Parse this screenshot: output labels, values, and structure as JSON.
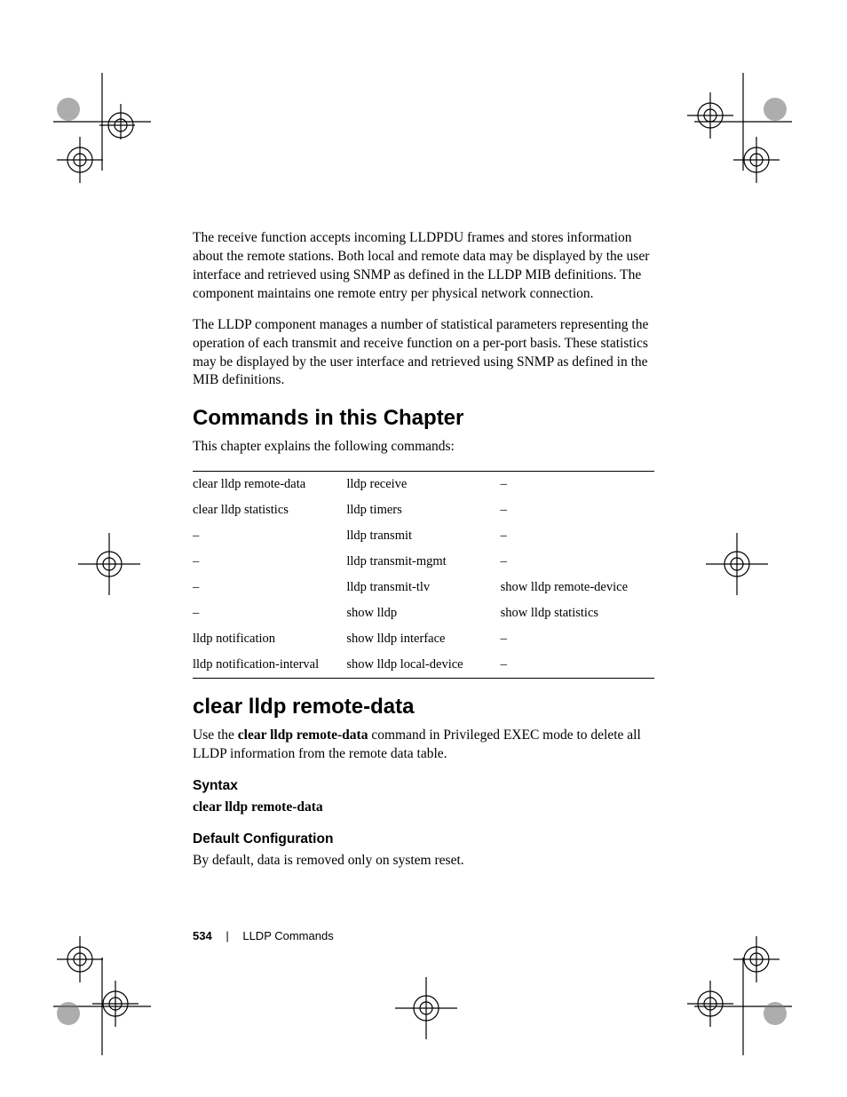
{
  "body": {
    "p1": "The receive function accepts incoming LLDPDU frames and stores information about the remote stations. Both local and remote data may be displayed by the user interface and retrieved using SNMP as defined in the LLDP MIB definitions. The component maintains one remote entry per physical network connection.",
    "p2": "The LLDP component manages a number of statistical parameters representing the operation of each transmit and receive function on a per-port basis. These statistics may be displayed by the user interface and retrieved using SNMP as defined in the MIB definitions."
  },
  "sections": {
    "commands_heading": "Commands in this Chapter",
    "commands_intro": "This chapter explains the following commands:",
    "clear_heading": "clear lldp remote-data",
    "clear_p1_a": "Use the ",
    "clear_p1_bold": "clear lldp remote-data",
    "clear_p1_b": " command in Privileged EXEC mode to delete all LLDP information from the remote data table.",
    "syntax_heading": "Syntax",
    "syntax_text": "clear lldp remote-data",
    "default_heading": "Default Configuration",
    "default_text": "By default, data is removed only on system reset."
  },
  "table": {
    "rows": [
      [
        "clear lldp remote-data",
        "lldp receive",
        "–"
      ],
      [
        "clear lldp statistics",
        "lldp timers",
        "–"
      ],
      [
        "–",
        "lldp transmit",
        "–"
      ],
      [
        "–",
        "lldp transmit-mgmt",
        "–"
      ],
      [
        "–",
        "lldp transmit-tlv",
        "show lldp remote-device"
      ],
      [
        "–",
        "show lldp",
        "show lldp statistics"
      ],
      [
        "lldp notification",
        "show lldp interface",
        "–"
      ],
      [
        "lldp notification-interval",
        "show lldp local-device",
        "–"
      ]
    ]
  },
  "footer": {
    "page": "534",
    "section": "LLDP Commands"
  }
}
